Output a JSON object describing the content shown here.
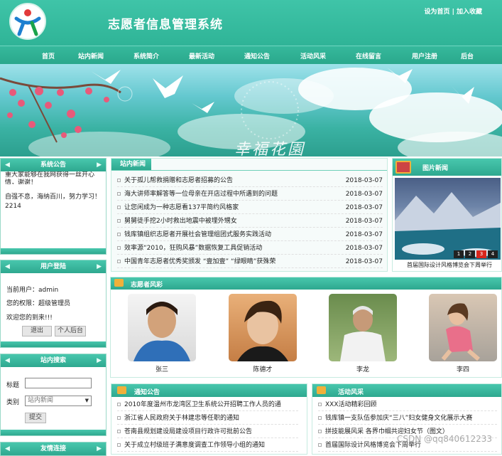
{
  "header": {
    "title": "志愿者信息管理系统",
    "links": "设为首页 | 加入收藏"
  },
  "nav": [
    "首页",
    "站内新闻",
    "系统简介",
    "最新活动",
    "通知公告",
    "活动风采",
    "在线留言",
    "用户注册",
    "后台"
  ],
  "banner": {
    "text": "幸福花園"
  },
  "sys_notice": {
    "title": "系统公告",
    "line1": "重大家能够在我网获得一丝开心情，谢谢！",
    "line2": "自强不息，海纳百川，努力学习！2214"
  },
  "login": {
    "title": "用户登陆",
    "user": "当前用户：admin",
    "role": "您的权限：超级管理员",
    "welcome": "欢迎您的到来!!!",
    "logout": "退出",
    "center": "个人后台"
  },
  "search": {
    "title": "站内搜索",
    "kw_label": "标题",
    "type_label": "类别",
    "type_value": "站内新闻",
    "submit": "提交"
  },
  "links_box": {
    "title": "友情连接"
  },
  "news": {
    "title": "站内新闻",
    "items": [
      {
        "t": "关于孤儿帮救捐赠和志愿者招募的公告",
        "d": "2018-03-07"
      },
      {
        "t": "海大讲师率解答等一位母亲在开店过程中所遇到的问题",
        "d": "2018-03-07"
      },
      {
        "t": "让您闲成为一种志愿看137平简约风格家",
        "d": "2018-03-07"
      },
      {
        "t": "舅舅徒手挖2小时救出地震中被埋外甥女",
        "d": "2018-03-07"
      },
      {
        "t": "钱库镇组织志愿者开展社会管理组团式服务实践活动",
        "d": "2018-03-07"
      },
      {
        "t": "效率源“2010，狂购风暴”数据恢复工具促销活动",
        "d": "2018-03-07"
      },
      {
        "t": "中国青年志愿者优秀奖颁发 “壹加壹” “绿眼睛”获殊荣",
        "d": "2018-03-07"
      }
    ]
  },
  "photo_news": {
    "title": "图片新闻",
    "pages": [
      "1",
      "2",
      "3",
      "4"
    ],
    "caption": "首届国际设计风格博览会下周举行"
  },
  "volunteers": {
    "title": "志愿者风彩",
    "people": [
      "张三",
      "陈德才",
      "李龙",
      "李四"
    ]
  },
  "notices": {
    "title": "通知公告",
    "items": [
      "2010年度温州市龙湾区卫生系统公开招聘工作人员的通",
      "浙江省人民政府关于林建忠等任职的通知",
      "苍南县规划建设局建设项目行政许可批前公告",
      "关于成立村级班子满意度调查工作领导小组的通知"
    ]
  },
  "activities": {
    "title": "活动风采",
    "items": [
      "XXX活动精彩回顾",
      "钱库镇一支队伍参加庆“三八”妇女健身文化展示大赛",
      "拼技能展风采 各界巾帼共迎妇女节（图文）",
      "首届国际设计风格博览会下周举行"
    ]
  },
  "watermark": "CSDN @qq840612233"
}
